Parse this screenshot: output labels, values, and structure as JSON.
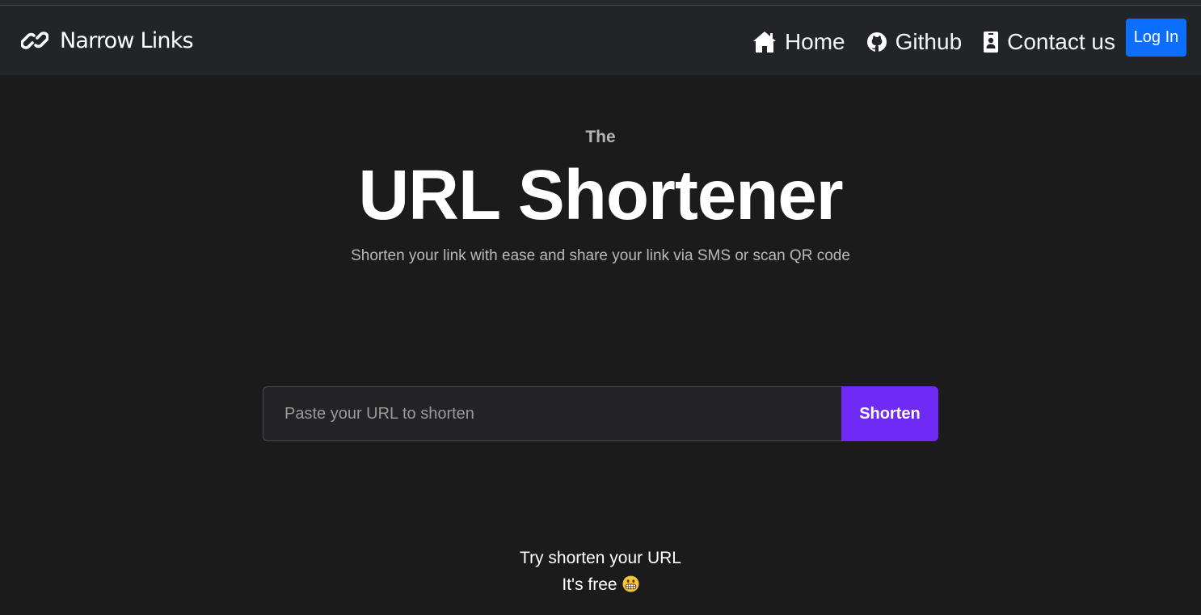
{
  "navbar": {
    "brand": {
      "text": "Narrow Links",
      "icon": "link-icon"
    },
    "links": [
      {
        "label": "Home",
        "icon": "home-icon"
      },
      {
        "label": "Github",
        "icon": "github-icon"
      },
      {
        "label": "Contact us",
        "icon": "contact-card-icon"
      }
    ],
    "login_label": "Log In"
  },
  "hero": {
    "pre_title": "The",
    "title": "URL Shortener",
    "subtitle": "Shorten your link with ease and share your link via SMS or scan QR code"
  },
  "form": {
    "input_value": "",
    "placeholder": "Paste your URL to shorten",
    "button_label": "Shorten"
  },
  "footer": {
    "line1": "Try shorten your URL",
    "line2": "It's free",
    "emoji_icon": "grinning-face-icon"
  },
  "colors": {
    "background": "#1b1b1c",
    "navbar": "#222428",
    "login_button": "#0d6efd",
    "shorten_button": "#6f2af6"
  }
}
